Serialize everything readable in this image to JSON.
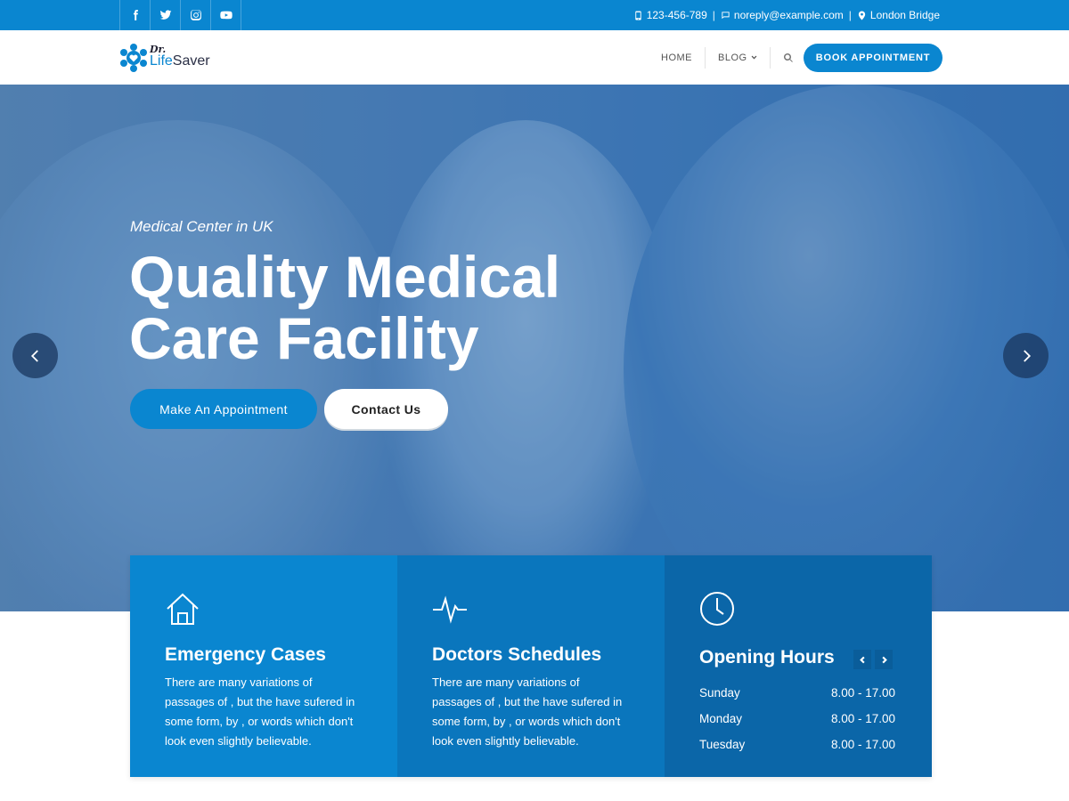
{
  "topbar": {
    "social": [
      "facebook-icon",
      "twitter-icon",
      "instagram-icon",
      "youtube-icon"
    ],
    "phone": "123-456-789",
    "email": "noreply@example.com",
    "location": "London Bridge",
    "separator": "|"
  },
  "header": {
    "logo_prefix": "Dr.",
    "logo_name_a": "Life",
    "logo_name_b": "Saver",
    "nav": {
      "home": "HOME",
      "blog": "BLOG"
    },
    "cta": "BOOK APPOINTMENT"
  },
  "hero": {
    "subtitle": "Medical Center in UK",
    "title_line1": "Quality Medical",
    "title_line2": "Care Facility",
    "primary_button": "Make An Appointment",
    "secondary_button": "Contact Us"
  },
  "features": {
    "emergency": {
      "title": "Emergency Cases",
      "text": "There are many variations of passages of , but the have sufered in some form, by , or words which don't look even slightly believable."
    },
    "schedules": {
      "title": "Doctors Schedules",
      "text": "There are many variations of passages of , but the have sufered in some form, by , or words which don't look even slightly believable."
    },
    "hours": {
      "title": "Opening Hours",
      "rows": [
        {
          "day": "Sunday",
          "time": "8.00 - 17.00"
        },
        {
          "day": "Monday",
          "time": "8.00 - 17.00"
        },
        {
          "day": "Tuesday",
          "time": "8.00 - 17.00"
        }
      ]
    }
  },
  "colors": {
    "brand": "#0a86d0",
    "card_mid": "#0a76bd",
    "card_dark": "#0b66a8"
  }
}
